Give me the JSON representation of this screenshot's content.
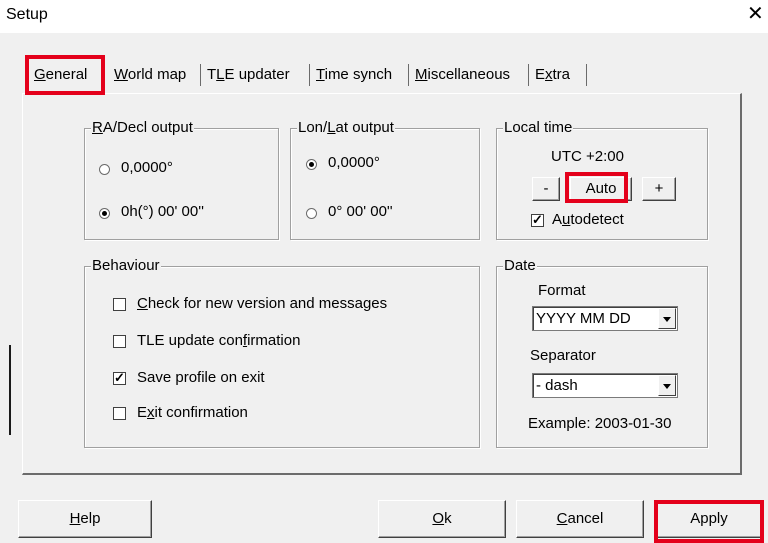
{
  "window": {
    "title": "Setup",
    "close_glyph": "✕"
  },
  "tabs": [
    {
      "pre": "",
      "ul": "G",
      "post": "eneral"
    },
    {
      "pre": "",
      "ul": "W",
      "post": "orld map"
    },
    {
      "pre": "T",
      "ul": "L",
      "post": "E updater"
    },
    {
      "pre": "",
      "ul": "T",
      "post": "ime synch"
    },
    {
      "pre": "",
      "ul": "M",
      "post": "iscellaneous"
    },
    {
      "pre": "E",
      "ul": "x",
      "post": "tra"
    }
  ],
  "radec": {
    "legend_ul": "R",
    "legend_rest": "A/Decl output",
    "opt_decimal": "0,0000°",
    "opt_dms": "0h(°) 00' 00''",
    "selected": "dms"
  },
  "lonlat": {
    "legend_pre": "Lon/",
    "legend_ul": "L",
    "legend_post": "at output",
    "opt_decimal": "0,0000°",
    "opt_dms": "0° 00' 00''",
    "selected": "decimal"
  },
  "localtime": {
    "legend": "Local time",
    "utc": "UTC +2:00",
    "minus": "-",
    "auto": "Auto",
    "plus": "+",
    "autodetect_pre": "A",
    "autodetect_ul": "u",
    "autodetect_post": "todetect",
    "autodetect_checked": true
  },
  "behaviour": {
    "legend": "Behaviour",
    "items": [
      {
        "pre": "",
        "ul": "C",
        "post": "heck for new version and messages",
        "checked": false
      },
      {
        "pre": "TLE update con",
        "ul": "f",
        "post": "irmation",
        "checked": false
      },
      {
        "pre": "Save profile on exit",
        "ul": "",
        "post": "",
        "checked": true
      },
      {
        "pre": "E",
        "ul": "x",
        "post": "it confirmation",
        "checked": false
      }
    ]
  },
  "date": {
    "legend": "Date",
    "format_label": "Format",
    "format_value": "YYYY MM DD",
    "separator_label": "Separator",
    "separator_value": "- dash",
    "example": "Example: 2003-01-30"
  },
  "buttons": {
    "help_ul": "H",
    "help_rest": "elp",
    "ok_ul": "O",
    "ok_rest": "k",
    "cancel_ul": "C",
    "cancel_rest": "ancel",
    "apply": "Apply"
  },
  "colors": {
    "highlight": "#e4001b",
    "dialog_bg": "#f0f0f0"
  }
}
